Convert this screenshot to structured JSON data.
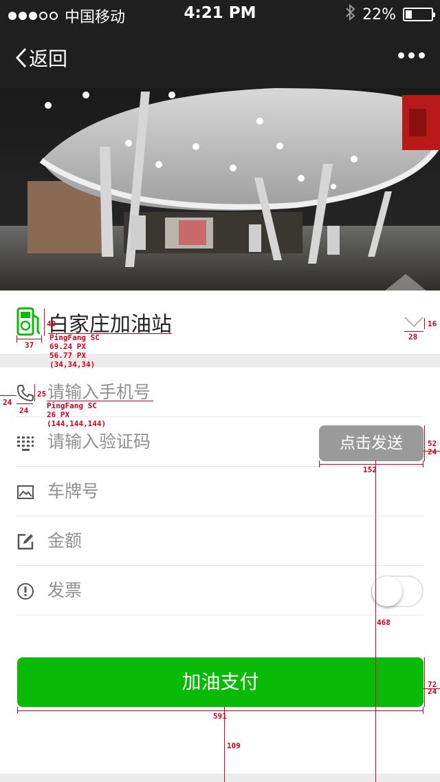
{
  "status_bar": {
    "carrier": "中国移动",
    "time": "4:21 PM",
    "battery": "22%",
    "battery_level": 0.22
  },
  "nav": {
    "back_label": "返回",
    "more_icon": "more-dots-icon"
  },
  "station": {
    "name": "白家庄加油站",
    "icon": "gas-pump-icon",
    "expand_icon": "chevron-down-icon"
  },
  "form": {
    "phone_placeholder": "请输入手机号",
    "code_placeholder": "请输入验证码",
    "send_label": "点击发送",
    "plate_placeholder": "车牌号",
    "amount_placeholder": "金额",
    "invoice_label": "发票",
    "invoice_enabled": false
  },
  "pay_button": "加油支付",
  "annotations": {
    "title_font": "PingFang SC",
    "title_size": "69.24 PX",
    "title_line": "56.77 PX",
    "title_color": "(34,34,34)",
    "title_h": "40",
    "icon_w": "37",
    "chev_h": "16",
    "chev_w": "28",
    "phone_h": "25",
    "phone_left": "24",
    "phone_icon_w": "24",
    "input_font": "PingFang SC",
    "input_size": "26 PX",
    "input_color": "(144,144,144)",
    "send_h": "52",
    "send_right": "24",
    "send_w": "152",
    "send_offset": "468",
    "pay_h": "72",
    "pay_right": "24",
    "pay_w": "591",
    "pay_offset": "109"
  },
  "colors": {
    "nav_bg": "#1f1f1f",
    "accent_green": "#09bb07",
    "send_bg": "#9a9a9a",
    "placeholder": "#909090",
    "title": "#222222",
    "annotation": "#d0021b"
  }
}
